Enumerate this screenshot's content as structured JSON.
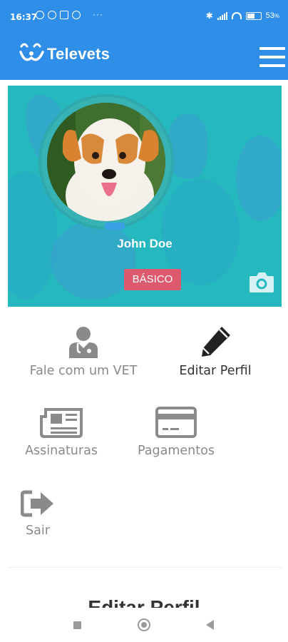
{
  "status_bar": {
    "time": "16:37",
    "extra": "···",
    "battery": "53"
  },
  "header": {
    "app_name": "Televets"
  },
  "profile": {
    "name": "John Doe",
    "plan": "BÁSICO"
  },
  "menu": {
    "talk_vet": "Fale com um VET",
    "edit_profile": "Editar Perfil",
    "subscriptions": "Assinaturas",
    "payments": "Pagamentos",
    "logout": "Sair"
  },
  "section": {
    "title": "Editar Perfil"
  },
  "colors": {
    "primary": "#2f8ee8",
    "banner": "#26b8bf",
    "plan_badge": "#dd5a6e"
  }
}
